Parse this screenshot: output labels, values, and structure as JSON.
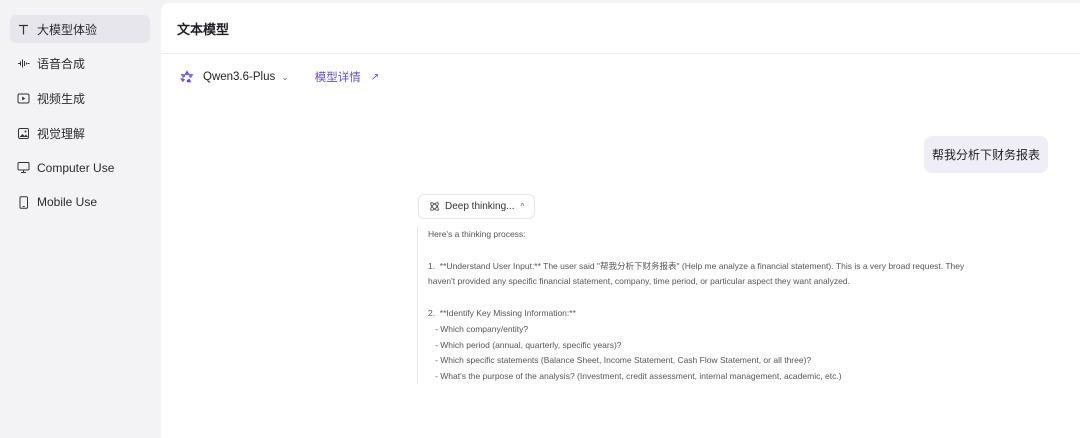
{
  "sidebar": {
    "items": [
      {
        "label": "大模型体验",
        "icon": "text-T-icon",
        "active": true
      },
      {
        "label": "语音合成",
        "icon": "waveform-icon",
        "active": false
      },
      {
        "label": "视频生成",
        "icon": "video-play-icon",
        "active": false
      },
      {
        "label": "视觉理解",
        "icon": "image-icon",
        "active": false
      },
      {
        "label": "Computer Use",
        "icon": "monitor-icon",
        "active": false
      },
      {
        "label": "Mobile Use",
        "icon": "mobile-icon",
        "active": false
      }
    ]
  },
  "header": {
    "title": "文本模型"
  },
  "model_selector": {
    "name": "Qwen3.6-Plus",
    "chevron": "⌄",
    "details_label": "模型详情",
    "details_arrow": "↗"
  },
  "chat": {
    "user_message": "帮我分析下财务报表",
    "thinking_toggle": {
      "label": "Deep thinking...",
      "chevron": "^"
    },
    "thinking_lines": [
      "Here's a thinking process:",
      "",
      "1.  **Understand User Input:** The user said \"帮我分析下财务报表\" (Help me analyze a financial statement). This is a very broad request. They",
      "haven't provided any specific financial statement, company, time period, or particular aspect they want analyzed.",
      "",
      "2.  **Identify Key Missing Information:**",
      "   - Which company/entity?",
      "   - Which period (annual, quarterly, specific years)?",
      "   - Which specific statements (Balance Sheet, Income Statement, Cash Flow Statement, or all three)?",
      "   - What's the purpose of the analysis? (Investment, credit assessment, internal management, academic, etc.)"
    ]
  },
  "colors": {
    "accent": "#5b4fd8",
    "sidebar_bg": "#f3f3f6",
    "bubble_bg": "#efeef7"
  }
}
